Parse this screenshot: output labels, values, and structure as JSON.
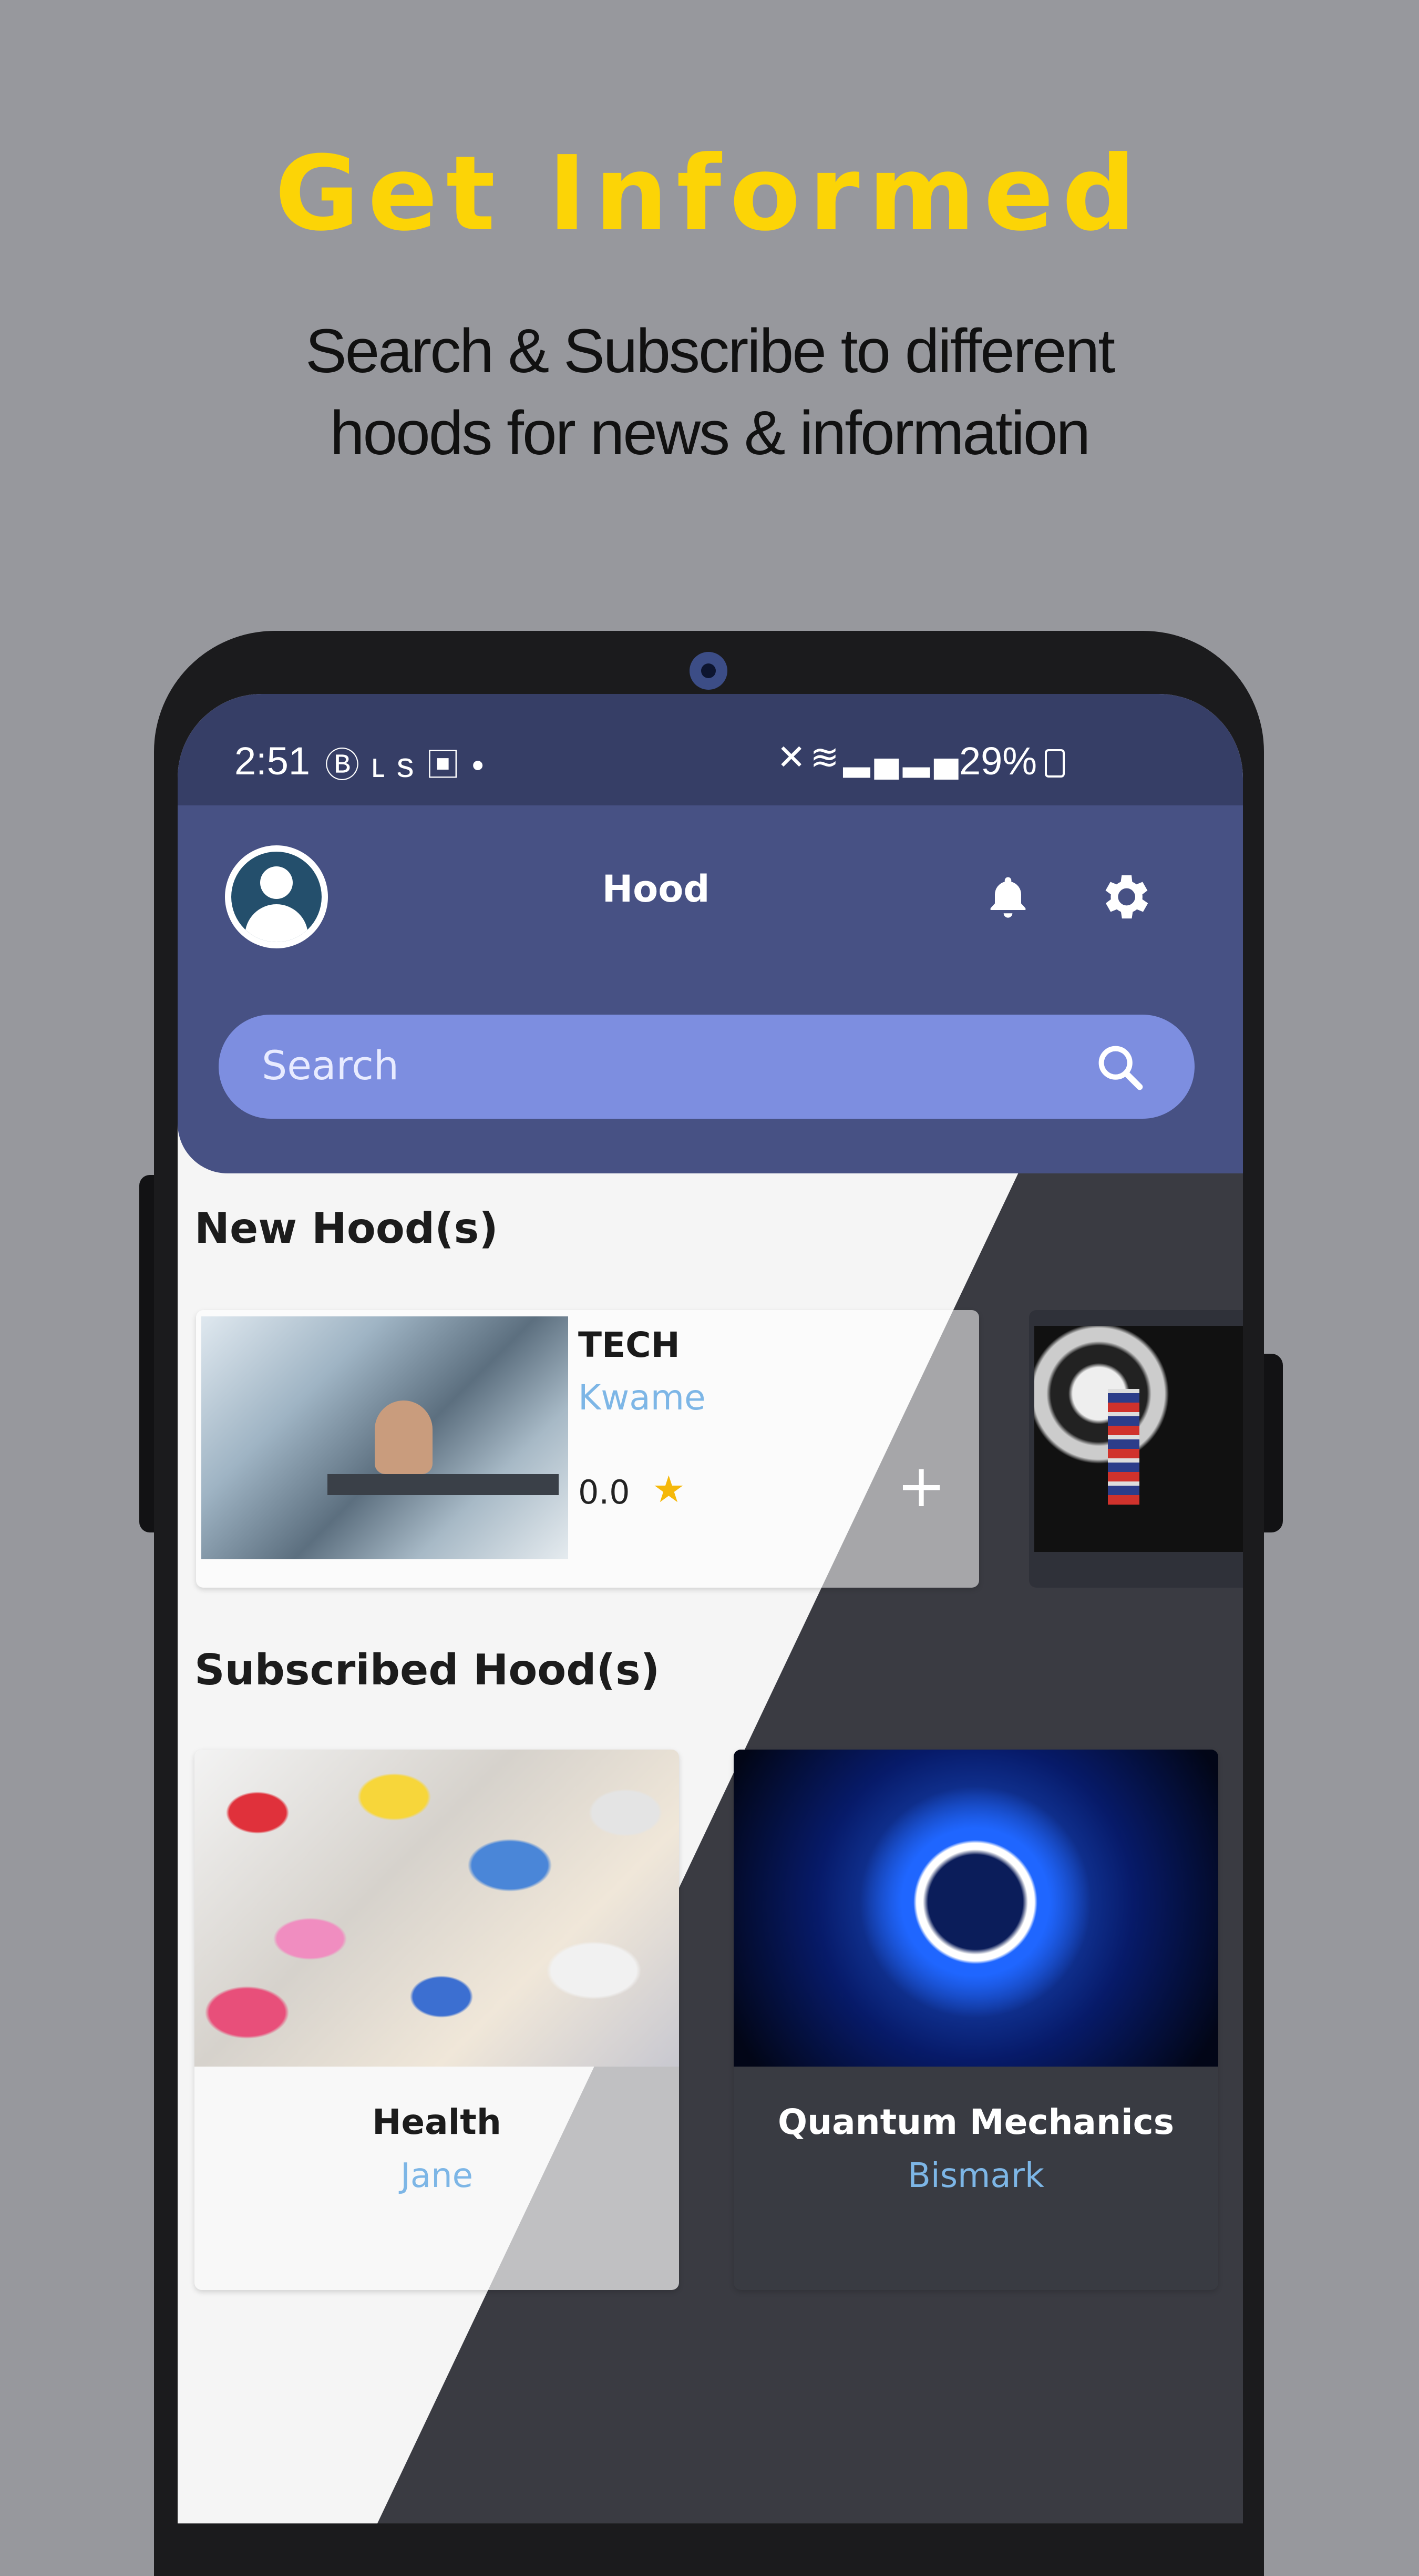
{
  "promo": {
    "title": "Get Informed",
    "subtitle_line1": "Search & Subscribe to different",
    "subtitle_line2": "hoods for news & information"
  },
  "status_bar": {
    "time": "2:51",
    "left_icons": [
      "b-circle-icon",
      "ls-icon",
      "image-icon",
      "dot-icon"
    ],
    "right_icons": [
      "mute-icon",
      "wifi-icon",
      "signal-icon",
      "signal-icon"
    ],
    "battery": "29%"
  },
  "header": {
    "title": "Hood",
    "icons": [
      "avatar-icon",
      "bell-icon",
      "gear-icon"
    ]
  },
  "search": {
    "placeholder": "Search"
  },
  "new_hoods": {
    "section_title": "New Hood(s)",
    "items": [
      {
        "title": "TECH",
        "owner": "Kwame",
        "rating": "0.0",
        "action": "+"
      }
    ]
  },
  "subscribed_hoods": {
    "section_title": "Subscribed Hood(s)",
    "items": [
      {
        "title": "Health",
        "owner": "Jane"
      },
      {
        "title": "Quantum Mechanics",
        "owner": "Bismark"
      }
    ]
  },
  "colors": {
    "promo_title": "#fcd406",
    "background": "#97989d",
    "status_bar": "#363e66",
    "app_bar": "#475184",
    "search_bar": "#7d8ee0",
    "owner_text": "#7db6e6",
    "dark_overlay": "#3a3b42"
  }
}
